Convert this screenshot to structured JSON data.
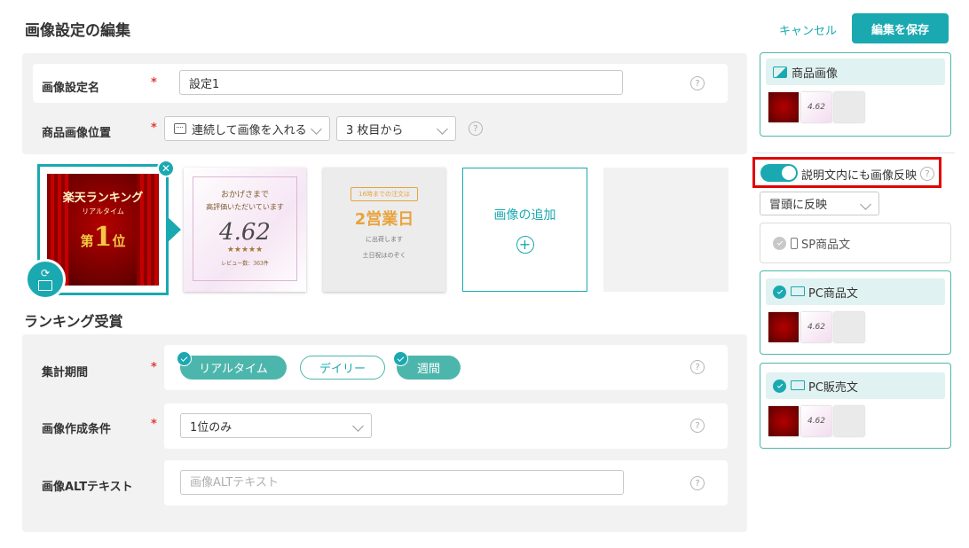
{
  "header": {
    "title": "画像設定の編集",
    "cancel_label": "キャンセル",
    "save_label": "編集を保存"
  },
  "settings": {
    "name_label": "画像設定名",
    "name_value": "設定1",
    "position_label": "商品画像位置",
    "position_mode": "連続して画像を入れる",
    "position_start": "3 枚目から"
  },
  "images": {
    "ranking": {
      "title": "楽天ランキング",
      "sub": "リアルタイム",
      "rank_prefix": "第",
      "rank_num": "1",
      "rank_suffix": "位"
    },
    "review": {
      "line1": "おかげさまで",
      "line2": "高評価いただいています",
      "score": "4.62",
      "stars": "★★★★★",
      "count": "レビュー数：363件"
    },
    "delivery": {
      "badge": "16時までの注文は",
      "title": "2営業日",
      "sub": "に出荷します",
      "note": "土日祝はのぞく"
    },
    "add_label": "画像の追加"
  },
  "ranking_section": {
    "title": "ランキング受賞",
    "period_label": "集計期間",
    "pills": [
      "リアルタイム",
      "デイリー",
      "週間"
    ],
    "condition_label": "画像作成条件",
    "condition_value": "1位のみ",
    "alt_label": "画像ALTテキスト",
    "alt_placeholder": "画像ALTテキスト"
  },
  "sidebar": {
    "product_image_label": "商品画像",
    "reflect_toggle_label": "説明文内にも画像反映",
    "reflect_position": "冒頭に反映",
    "sp_label": "SP商品文",
    "pc_product_label": "PC商品文",
    "pc_sales_label": "PC販売文",
    "mini_score": "4.62"
  },
  "colors": {
    "accent": "#1aa9b0",
    "highlight": "#e00000"
  }
}
